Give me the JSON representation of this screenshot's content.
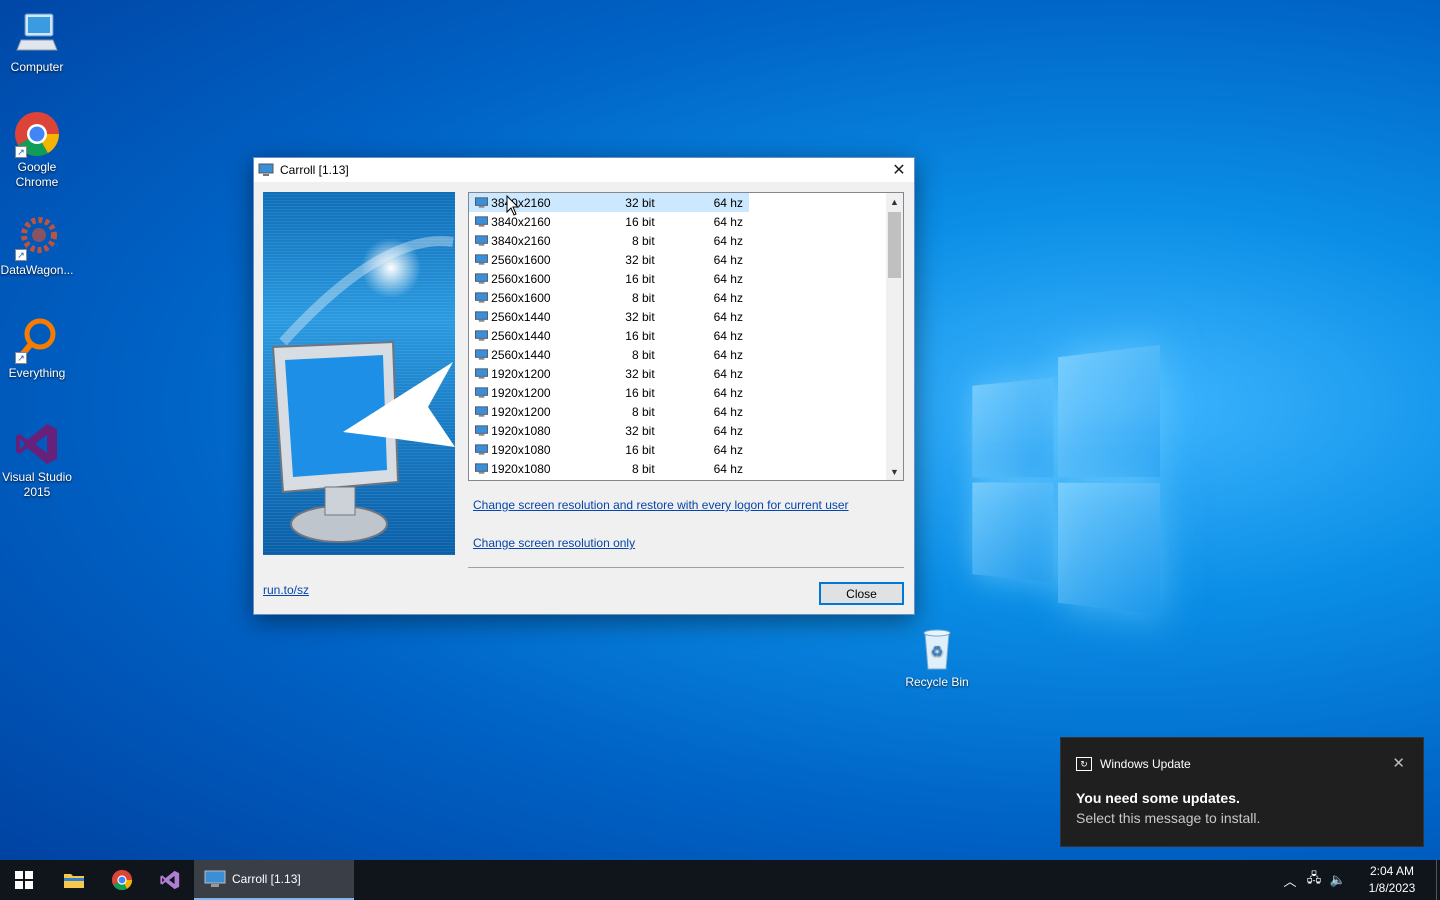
{
  "desktop": {
    "icons": [
      {
        "label": "Computer",
        "icon": "computer-icon"
      },
      {
        "label": "Google Chrome",
        "icon": "chrome-icon"
      },
      {
        "label": "DataWagon...",
        "icon": "datawagon-icon"
      },
      {
        "label": "Everything",
        "icon": "everything-search-icon"
      },
      {
        "label": "Visual Studio 2015",
        "icon": "visual-studio-icon"
      },
      {
        "label": "Recycle Bin",
        "icon": "recycle-bin-icon"
      }
    ]
  },
  "dialog": {
    "title": "Carroll [1.13]",
    "modes": [
      {
        "res": "3840x2160",
        "bits": "32 bit",
        "hz": "64 hz",
        "selected": true
      },
      {
        "res": "3840x2160",
        "bits": "16 bit",
        "hz": "64 hz"
      },
      {
        "res": "3840x2160",
        "bits": "8 bit",
        "hz": "64 hz"
      },
      {
        "res": "2560x1600",
        "bits": "32 bit",
        "hz": "64 hz"
      },
      {
        "res": "2560x1600",
        "bits": "16 bit",
        "hz": "64 hz"
      },
      {
        "res": "2560x1600",
        "bits": "8 bit",
        "hz": "64 hz"
      },
      {
        "res": "2560x1440",
        "bits": "32 bit",
        "hz": "64 hz"
      },
      {
        "res": "2560x1440",
        "bits": "16 bit",
        "hz": "64 hz"
      },
      {
        "res": "2560x1440",
        "bits": "8 bit",
        "hz": "64 hz"
      },
      {
        "res": "1920x1200",
        "bits": "32 bit",
        "hz": "64 hz"
      },
      {
        "res": "1920x1200",
        "bits": "16 bit",
        "hz": "64 hz"
      },
      {
        "res": "1920x1200",
        "bits": "8 bit",
        "hz": "64 hz"
      },
      {
        "res": "1920x1080",
        "bits": "32 bit",
        "hz": "64 hz"
      },
      {
        "res": "1920x1080",
        "bits": "16 bit",
        "hz": "64 hz"
      },
      {
        "res": "1920x1080",
        "bits": "8 bit",
        "hz": "64 hz"
      }
    ],
    "link_restore": "Change screen resolution and restore with every logon for current user",
    "link_change_only": "Change screen resolution only",
    "link_site": "run.to/sz",
    "close_label": "Close"
  },
  "toast": {
    "app": "Windows Update",
    "title": "You need some updates.",
    "body": "Select this message to install."
  },
  "taskbar": {
    "active_app": "Carroll [1.13]",
    "time": "2:04 AM",
    "date": "1/8/2023"
  }
}
